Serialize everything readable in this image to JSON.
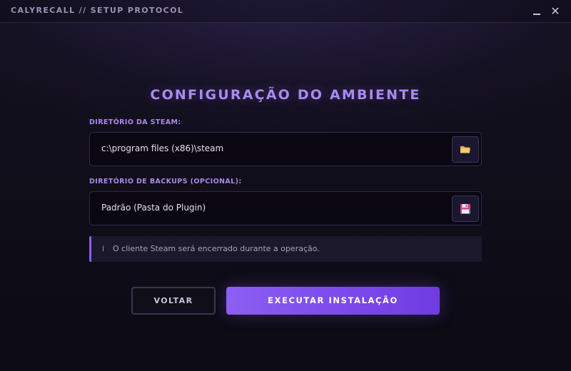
{
  "window": {
    "title": "CALYRECALL // SETUP PROTOCOL",
    "minimize_icon": "minimize-icon",
    "close_label": "✕"
  },
  "main": {
    "heading": "CONFIGURAÇÃO DO AMBIENTE",
    "steam_dir": {
      "label": "DIRETÓRIO DA STEAM:",
      "value": "c:\\program files (x86)\\steam",
      "button_icon": "folder-icon"
    },
    "backup_dir": {
      "label": "DIRETÓRIO DE BACKUPS (OPCIONAL):",
      "value": "Padrão (Pasta do Plugin)",
      "button_icon": "floppy-disk-icon"
    },
    "notice": {
      "icon": "i",
      "text": "O cliente Steam será encerrado durante a operação."
    }
  },
  "actions": {
    "back_label": "VOLTAR",
    "run_label": "EXECUTAR INSTALAÇÃO"
  },
  "colors": {
    "accent": "#8b5cf6",
    "heading": "#a98af0",
    "background": "#0f0d18"
  }
}
